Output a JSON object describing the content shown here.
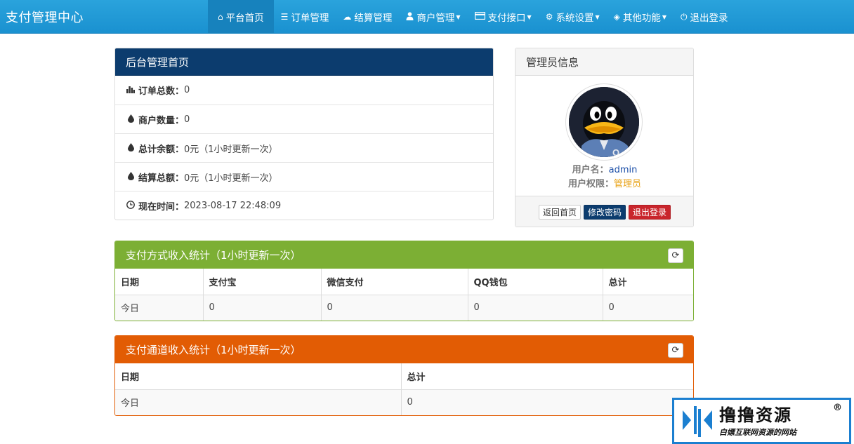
{
  "brand": "支付管理中心",
  "nav": [
    {
      "label": "平台首页",
      "icon": "home-icon",
      "glyph": "⌂",
      "dropdown": false,
      "active": true
    },
    {
      "label": "订单管理",
      "icon": "list-icon",
      "glyph": "☰",
      "dropdown": false,
      "active": false
    },
    {
      "label": "结算管理",
      "icon": "cloud-icon",
      "glyph": "☁",
      "dropdown": false,
      "active": false
    },
    {
      "label": "商户管理",
      "icon": "user-icon",
      "glyph": "👤",
      "dropdown": true,
      "active": false
    },
    {
      "label": "支付接口",
      "icon": "credit-card-icon",
      "glyph": "▭",
      "dropdown": true,
      "active": false
    },
    {
      "label": "系统设置",
      "icon": "gear-icon",
      "glyph": "⚙",
      "dropdown": true,
      "active": false
    },
    {
      "label": "其他功能",
      "icon": "cube-icon",
      "glyph": "◈",
      "dropdown": true,
      "active": false
    },
    {
      "label": "退出登录",
      "icon": "power-icon",
      "glyph": "⏻",
      "dropdown": false,
      "active": false
    }
  ],
  "overview": {
    "title": "后台管理首页",
    "rows": [
      {
        "icon": "bar-chart-icon",
        "glyph": "▮",
        "label": "订单总数：",
        "value": "0"
      },
      {
        "icon": "drop-icon",
        "glyph": "💧",
        "label": "商户数量：",
        "value": "0"
      },
      {
        "icon": "drop-icon",
        "glyph": "💧",
        "label": "总计余额：",
        "value": "0元（1小时更新一次）"
      },
      {
        "icon": "drop-icon",
        "glyph": "💧",
        "label": "结算总额：",
        "value": "0元（1小时更新一次）"
      },
      {
        "icon": "clock-icon",
        "glyph": "◷",
        "label": "现在时间：",
        "value": "2023-08-17 22:48:09"
      }
    ]
  },
  "admin": {
    "title": "管理员信息",
    "username_label": "用户名：",
    "username": "admin",
    "role_label": "用户权限：",
    "role": "管理员",
    "buttons": {
      "home": "返回首页",
      "password": "修改密码",
      "logout": "退出登录"
    }
  },
  "paytype": {
    "title": "支付方式收入统计（1小时更新一次）",
    "headers": [
      "日期",
      "支付宝",
      "微信支付",
      "QQ钱包",
      "总计"
    ],
    "row": [
      "今日",
      "0",
      "0",
      "0",
      "0"
    ]
  },
  "channel": {
    "title": "支付通道收入统计（1小时更新一次）",
    "headers": [
      "日期",
      "总计"
    ],
    "row": [
      "今日",
      "0"
    ]
  },
  "watermark": {
    "title": "撸撸资源",
    "subtitle": "白嫖互联网资源的网站",
    "reg": "®"
  },
  "colors": {
    "navbar": "#1a91d0",
    "overview_header": "#0c3c6e",
    "paytype_header": "#7caf34",
    "channel_header": "#e25c04",
    "link_blue": "#1c4fa8",
    "role_orange": "#e8a114"
  }
}
